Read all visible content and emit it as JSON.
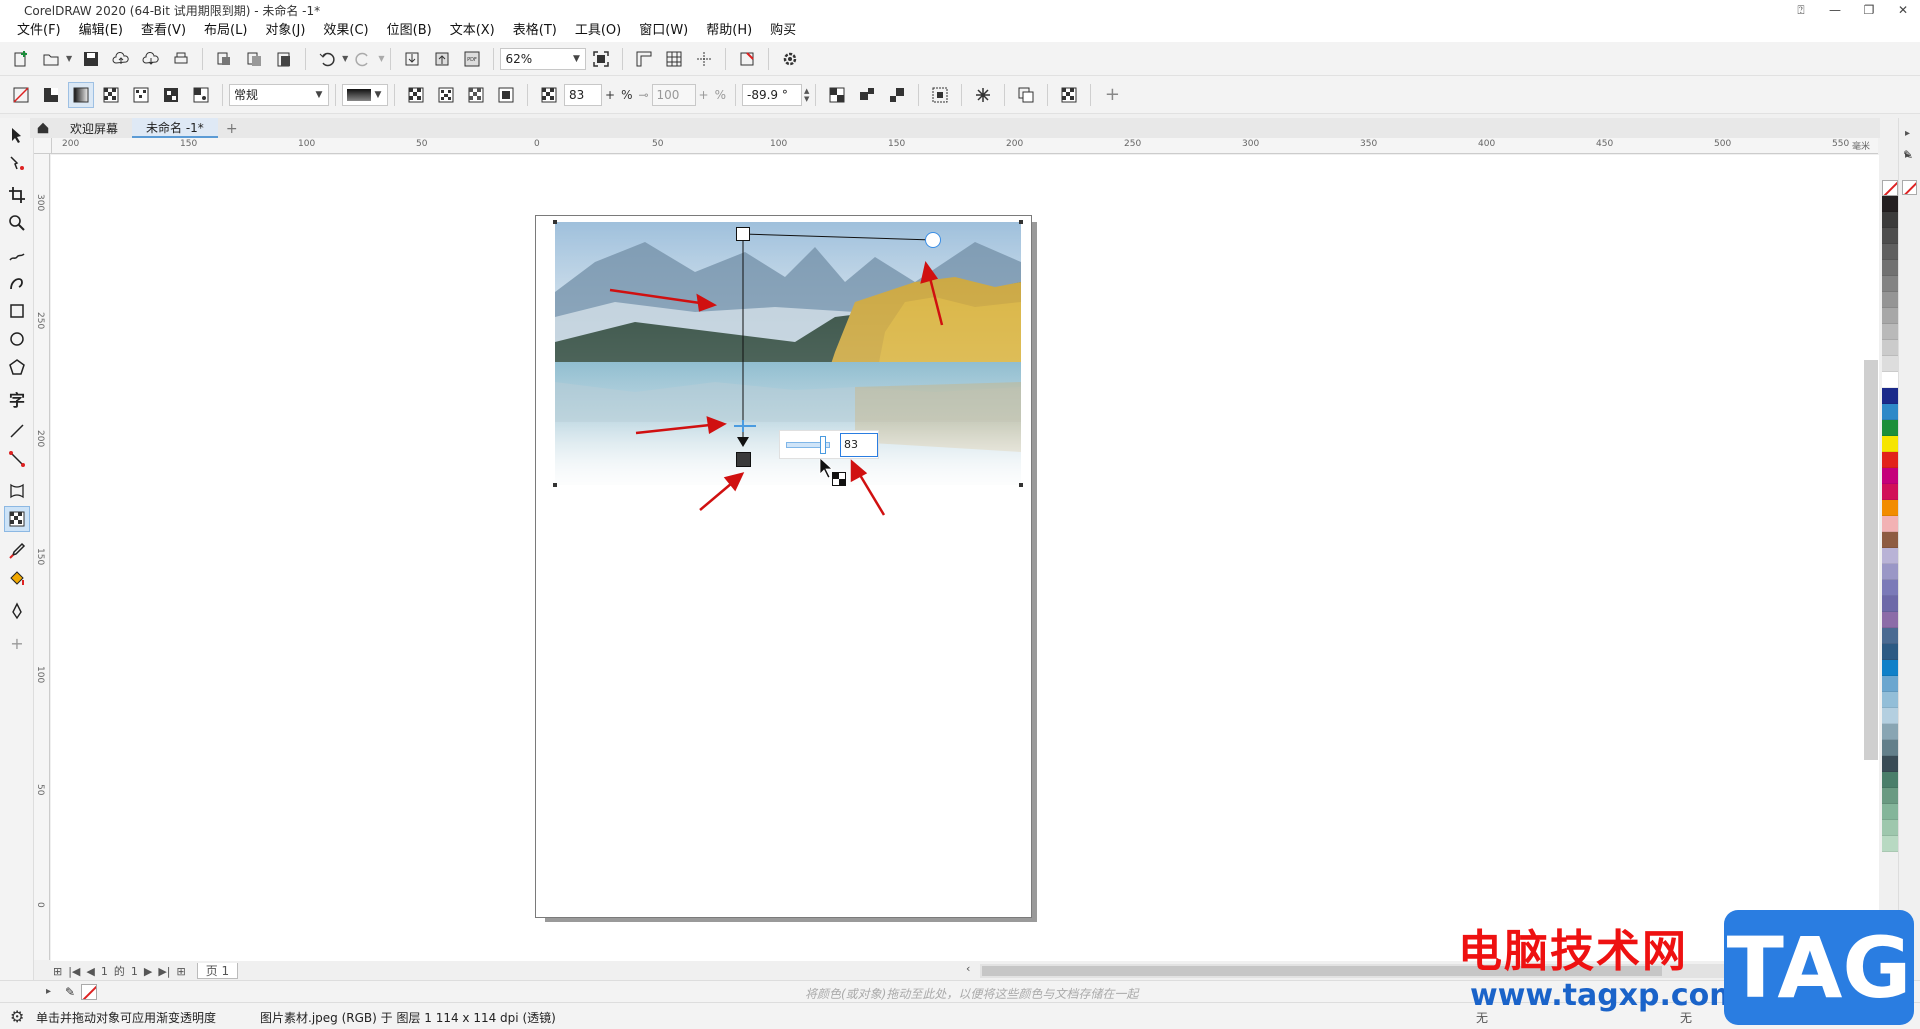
{
  "window": {
    "title": "CorelDRAW 2020 (64-Bit 试用期限到期) - 未命名 -1*"
  },
  "menu": [
    "文件(F)",
    "编辑(E)",
    "查看(V)",
    "布局(L)",
    "对象(J)",
    "效果(C)",
    "位图(B)",
    "文本(X)",
    "表格(T)",
    "工具(O)",
    "窗口(W)",
    "帮助(H)",
    "购买"
  ],
  "toolbar1": {
    "zoom": "62%"
  },
  "toolbar2": {
    "merge_mode": "常规",
    "transparency": "83",
    "percent_sign": "%",
    "midpoint": "100",
    "angle": "-89.9 °"
  },
  "tabs": [
    {
      "label": "欢迎屏幕",
      "active": false
    },
    {
      "label": "未命名 -1*",
      "active": true
    }
  ],
  "ruler": {
    "h_labels": [
      "200",
      "150",
      "100",
      "50",
      "0",
      "50",
      "100",
      "150",
      "200",
      "250",
      "300",
      "350",
      "400",
      "450",
      "500",
      "550"
    ],
    "h_unit": "毫米",
    "v_labels": [
      "300",
      "250",
      "200",
      "150",
      "100",
      "50",
      "0"
    ]
  },
  "transparency_popup": {
    "value": "83"
  },
  "page_navigator": {
    "current": "1",
    "of_label": "的",
    "total": "1",
    "page_tab": "页 1"
  },
  "colorbar": {
    "hint": "将颜色(或对象)拖动至此处，以便将这些颜色与文档存储在一起"
  },
  "status": {
    "hint": "单击并拖动对象可应用渐变透明度",
    "object_info": "图片素材.jpeg (RGB) 于 图层 1 114 x 114 dpi (透镜)",
    "fill": "无",
    "outline": "无"
  },
  "palette": [
    "#231f20",
    "#3b3b3b",
    "#4d4d4d",
    "#5f5f5f",
    "#717171",
    "#838383",
    "#959595",
    "#a7a7a7",
    "#b9b9b9",
    "#cbcbcb",
    "#dddddd",
    "#ffffff",
    "#1b2a8a",
    "#2e89c8",
    "#1c8f3a",
    "#f6e500",
    "#e2231a",
    "#c5007a",
    "#d10f58",
    "#f28c00",
    "#f2b2b4",
    "#8e5c42",
    "#b9b3d6",
    "#9a97c6",
    "#7b7ab8",
    "#6d69a8",
    "#8c6ca8",
    "#4a6a92",
    "#2c5a84",
    "#1080c8",
    "#6ba6cf",
    "#93bed8",
    "#b4cfe0",
    "#89a5b3",
    "#637f8a",
    "#394b55",
    "#4a7e6a",
    "#6a9a82",
    "#84b59a",
    "#9ec7ad",
    "#b8d9c2"
  ],
  "watermark": {
    "cn": "电脑技术网",
    "url": "www.tagxp.com",
    "badge": "TAG"
  }
}
